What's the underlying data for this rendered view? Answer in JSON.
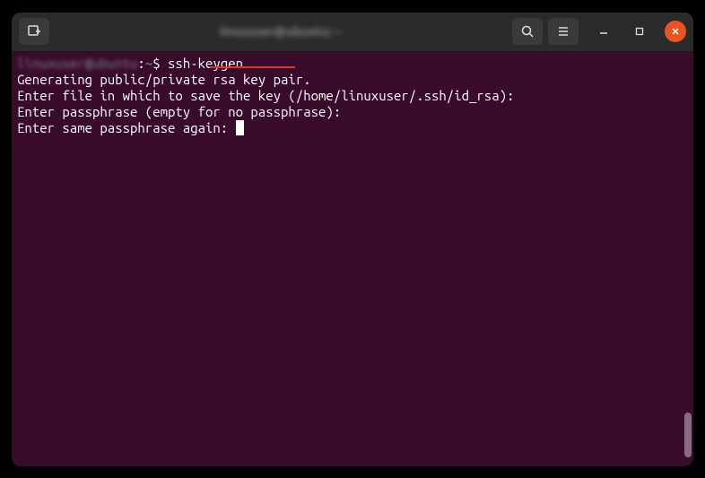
{
  "titlebar": {
    "title": "linuxuser@ubuntu: ~"
  },
  "terminal": {
    "prompt_user": "linuxuser@ubuntu",
    "prompt_sep": ":",
    "prompt_path": "~",
    "prompt_symbol": "$ ",
    "command": "ssh-keygen",
    "output": [
      "Generating public/private rsa key pair.",
      "Enter file in which to save the key (/home/linuxuser/.ssh/id_rsa): ",
      "Enter passphrase (empty for no passphrase): ",
      "Enter same passphrase again: "
    ]
  },
  "colors": {
    "terminal_bg": "#380c2a",
    "titlebar_bg": "#2b2b2b",
    "close_btn": "#e95420",
    "highlight": "#d33"
  }
}
